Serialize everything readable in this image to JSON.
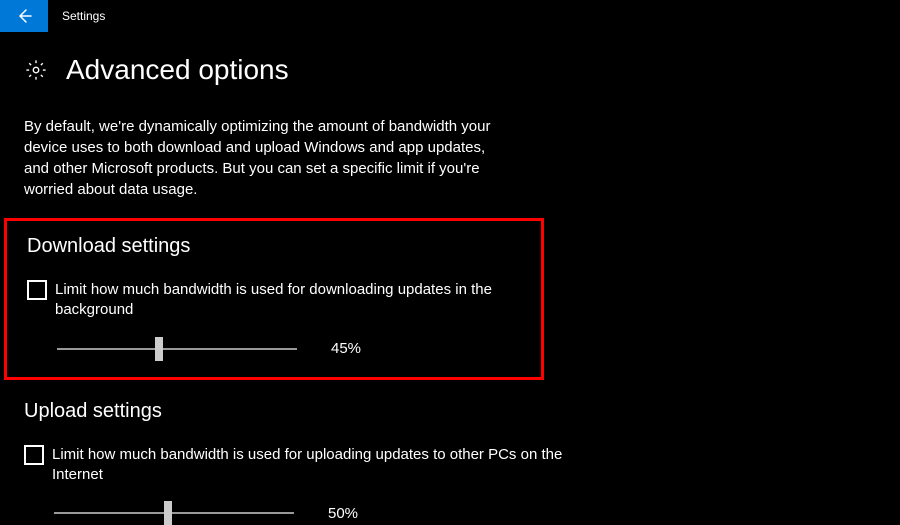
{
  "titlebar": {
    "app_name": "Settings"
  },
  "header": {
    "title": "Advanced options",
    "gear_icon": "gear-icon"
  },
  "description": "By default, we're dynamically optimizing the amount of bandwidth your device uses to both download and upload Windows and app updates, and other Microsoft products. But you can set a specific limit if you're worried about data usage.",
  "download": {
    "section_title": "Download settings",
    "checkbox_label": "Limit how much bandwidth is used for downloading updates in the background",
    "checkbox_checked": false,
    "slider_value": 45,
    "slider_display": "45%"
  },
  "upload": {
    "section_title": "Upload settings",
    "checkbox_label": "Limit how much bandwidth is used for uploading updates to other PCs on the Internet",
    "checkbox_checked": false,
    "slider_value": 50,
    "slider_display": "50%"
  }
}
